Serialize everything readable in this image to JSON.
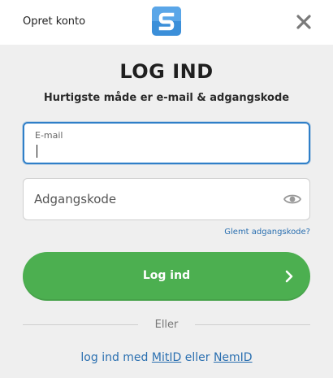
{
  "header": {
    "create_account_label": "Opret konto",
    "logo_icon": "s-logo-icon",
    "close_icon": "close-icon"
  },
  "main": {
    "title": "LOG IND",
    "subtitle": "Hurtigste måde er e-mail & adgangskode"
  },
  "form": {
    "email_label": "E-mail",
    "email_value": "",
    "password_placeholder": "Adgangskode",
    "password_value": "",
    "show_password_icon": "eye-icon",
    "forgot_label": "Glemt adgangskode?",
    "login_label": "Log ind",
    "login_icon": "chevron-right-icon"
  },
  "divider": {
    "text": "Eller"
  },
  "alt_login": {
    "prefix": "log ind med",
    "mitid": "MitID",
    "middle": "eller",
    "nemid": "NemID"
  },
  "colors": {
    "accent_blue": "#2f7fc8",
    "brand_logo": "#3b8fd9",
    "button_green": "#4caf50",
    "link_blue": "#2a6fb0",
    "background": "#efefef"
  }
}
